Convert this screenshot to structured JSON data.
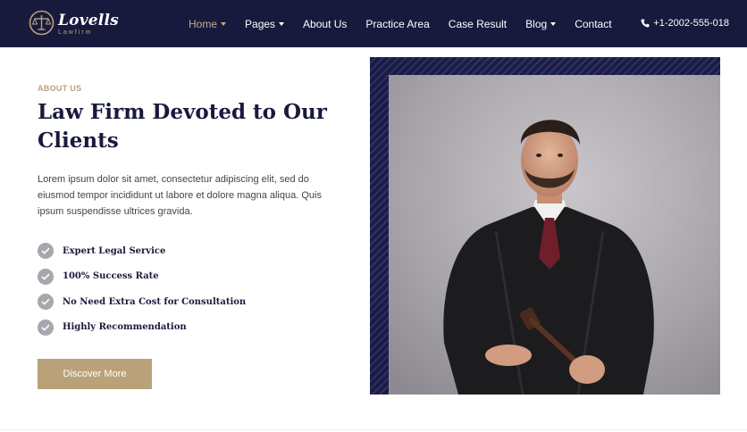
{
  "brand": {
    "name": "Lovells",
    "sub": "Lawfirm"
  },
  "nav": {
    "items": [
      {
        "label": "Home",
        "dropdown": true,
        "active": true
      },
      {
        "label": "Pages",
        "dropdown": true,
        "active": false
      },
      {
        "label": "About Us",
        "dropdown": false,
        "active": false
      },
      {
        "label": "Practice Area",
        "dropdown": false,
        "active": false
      },
      {
        "label": "Case Result",
        "dropdown": false,
        "active": false
      },
      {
        "label": "Blog",
        "dropdown": true,
        "active": false
      },
      {
        "label": "Contact",
        "dropdown": false,
        "active": false
      }
    ],
    "phone": "+1-2002-555-018",
    "phone_icon": "phone-icon"
  },
  "about": {
    "eyebrow": "ABOUT US",
    "title": "Law Firm Devoted to Our Clients",
    "description": "Lorem ipsum dolor sit amet, consectetur adipiscing elit, sed do eiusmod tempor incididunt ut labore et dolore magna aliqua. Quis ipsum suspendisse ultrices gravida.",
    "features": [
      "Expert Legal Service",
      "100% Success Rate",
      "No Need Extra Cost for Consultation",
      "Highly Recommendation"
    ],
    "button_label": "Discover More"
  },
  "colors": {
    "navy": "#181a3d",
    "gold": "#b9a27a",
    "check_bg": "#a7a7ae"
  }
}
